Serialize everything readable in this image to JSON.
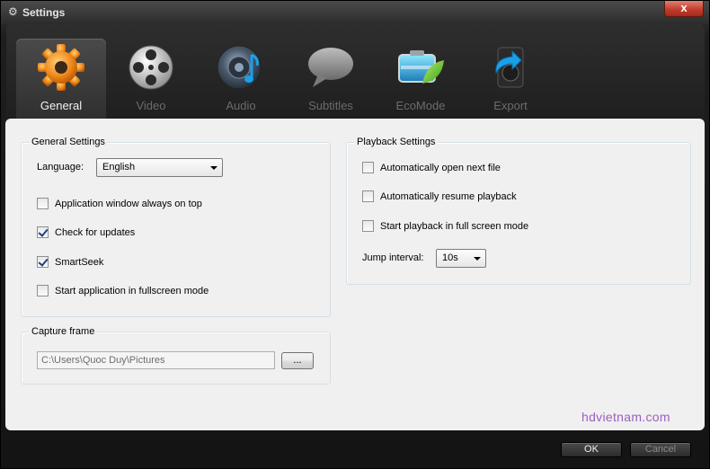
{
  "window": {
    "title": "Settings",
    "close": "x"
  },
  "tabs": [
    {
      "label": "General",
      "icon": "gear-icon",
      "active": true
    },
    {
      "label": "Video",
      "icon": "film-reel-icon",
      "active": false
    },
    {
      "label": "Audio",
      "icon": "speaker-icon",
      "active": false
    },
    {
      "label": "Subtitles",
      "icon": "speech-bubble-icon",
      "active": false
    },
    {
      "label": "EcoMode",
      "icon": "battery-leaf-icon",
      "active": false
    },
    {
      "label": "Export",
      "icon": "export-device-icon",
      "active": false
    }
  ],
  "general": {
    "legend": "General Settings",
    "language_label": "Language:",
    "language_value": "English",
    "options": [
      {
        "label": "Application window always on top",
        "checked": false
      },
      {
        "label": "Check for updates",
        "checked": true
      },
      {
        "label": "SmartSeek",
        "checked": true
      },
      {
        "label": "Start application in fullscreen mode",
        "checked": false
      }
    ]
  },
  "capture": {
    "legend": "Capture frame",
    "path": "C:\\Users\\Quoc Duy\\Pictures",
    "browse_label": "..."
  },
  "playback": {
    "legend": "Playback Settings",
    "options": [
      {
        "label": "Automatically open next file",
        "checked": false
      },
      {
        "label": "Automatically resume playback",
        "checked": false
      },
      {
        "label": "Start playback in full screen mode",
        "checked": false
      }
    ],
    "jump_label": "Jump interval:",
    "jump_value": "10s"
  },
  "watermark": "hdvietnam.com",
  "footer": {
    "ok": "OK",
    "cancel": "Cancel"
  },
  "colors": {
    "accent_orange": "#f08a1c",
    "watermark": "#9b5fc0"
  }
}
